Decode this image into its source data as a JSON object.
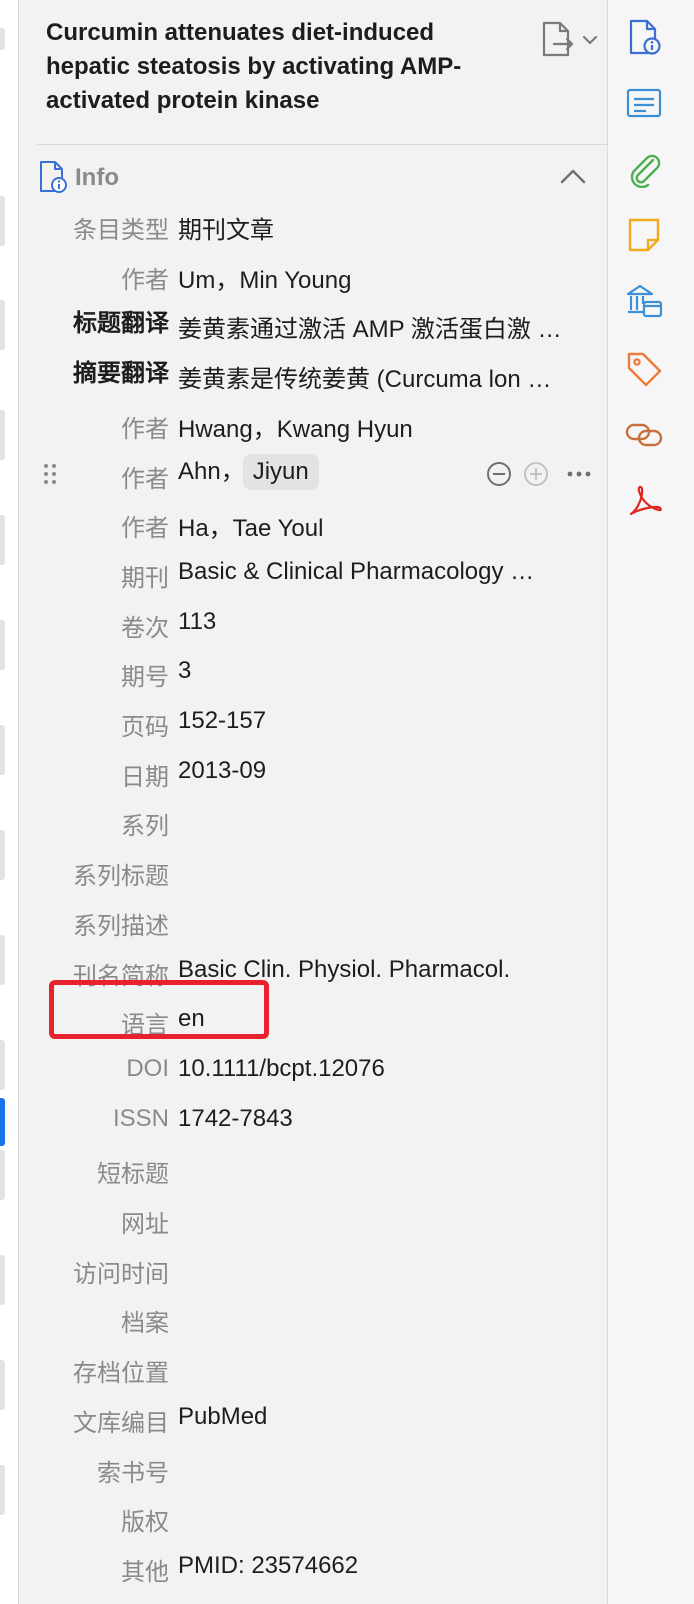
{
  "item": {
    "title": "Curcumin attenuates diet-induced hepatic steatosis by activating AMP-activated protein kinase"
  },
  "section": {
    "label": "Info"
  },
  "fields": [
    {
      "label": "条目类型",
      "value": "期刊文章"
    },
    {
      "label": "作者",
      "value": "Um，Min Young"
    },
    {
      "label": "标题翻译",
      "value": "姜黄素通过激活 AMP 激活蛋白激 …"
    },
    {
      "label": "摘要翻译",
      "value": "姜黄素是传统姜黄 (Curcuma lon …"
    },
    {
      "label": "作者",
      "value": "Hwang，Kwang Hyun"
    },
    {
      "label": "作者",
      "value_last": "Ahn，",
      "value_first": "Jiyun"
    },
    {
      "label": "作者",
      "value": "Ha，Tae Youl"
    },
    {
      "label": "期刊",
      "value": "Basic & Clinical Pharmacology   …"
    },
    {
      "label": "卷次",
      "value": "113"
    },
    {
      "label": "期号",
      "value": "3"
    },
    {
      "label": "页码",
      "value": "152-157"
    },
    {
      "label": "日期",
      "value": "2013-09"
    },
    {
      "label": "系列",
      "value": ""
    },
    {
      "label": "系列标题",
      "value": ""
    },
    {
      "label": "系列描述",
      "value": ""
    },
    {
      "label": "刊名简称",
      "value": "Basic Clin. Physiol. Pharmacol."
    },
    {
      "label": "语言",
      "value": "en"
    },
    {
      "label": "DOI",
      "value": "10.1111/bcpt.12076"
    },
    {
      "label": "ISSN",
      "value": "1742-7843"
    },
    {
      "label": "短标题",
      "value": ""
    },
    {
      "label": "网址",
      "value": ""
    },
    {
      "label": "访问时间",
      "value": ""
    },
    {
      "label": "档案",
      "value": ""
    },
    {
      "label": "存档位置",
      "value": ""
    },
    {
      "label": "文库编目",
      "value": "PubMed"
    },
    {
      "label": "索书号",
      "value": ""
    },
    {
      "label": "版权",
      "value": ""
    },
    {
      "label": "其他",
      "value": "PMID: 23574662"
    }
  ],
  "icons": {
    "sidebar": [
      "info-doc-icon",
      "abstract-icon",
      "attachment-icon",
      "note-icon",
      "library-icon",
      "tag-icon",
      "related-icon",
      "pdf-icon"
    ]
  },
  "colors": {
    "highlight": "#e8222c",
    "info": "#3b6fd6",
    "attachment": "#4caf50",
    "note": "#f2a81d",
    "tag": "#f07a3a",
    "related": "#c7703e",
    "pdf": "#e0261f"
  }
}
